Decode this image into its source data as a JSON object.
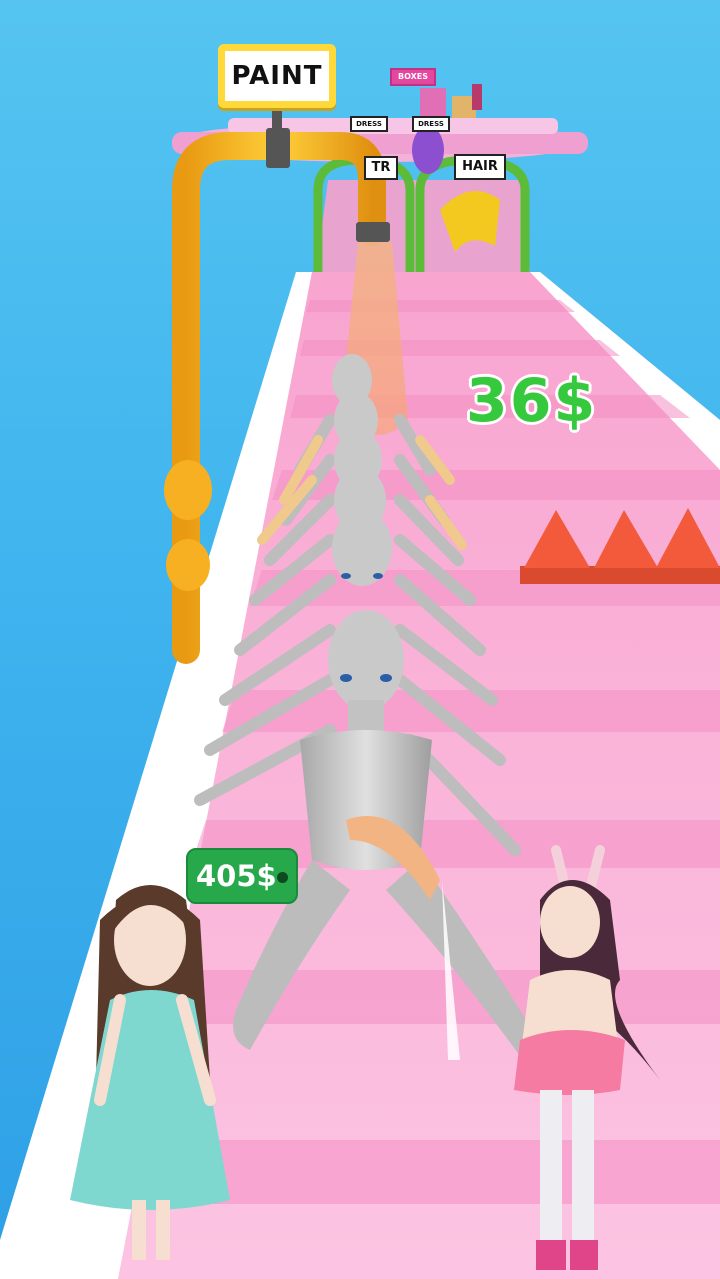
{
  "signs": {
    "paint": "PAINT",
    "boxes": "BOXES",
    "dress_left": "DRESS",
    "dress_right": "DRESS",
    "tr_partial": "TR",
    "hair": "HAIR"
  },
  "hud": {
    "money_total": "405$",
    "money_popup": "36$"
  },
  "colors": {
    "sky": "#3fb4ee",
    "track": "#f9a9d4",
    "pipe": "#f7b52c",
    "spikes": "#f25a3b",
    "money_badge": "#27a84a",
    "money_popup": "#36c93e",
    "mannequin": "#c8c8c8"
  },
  "game_state": {
    "mannequin_count_visible": 13
  }
}
